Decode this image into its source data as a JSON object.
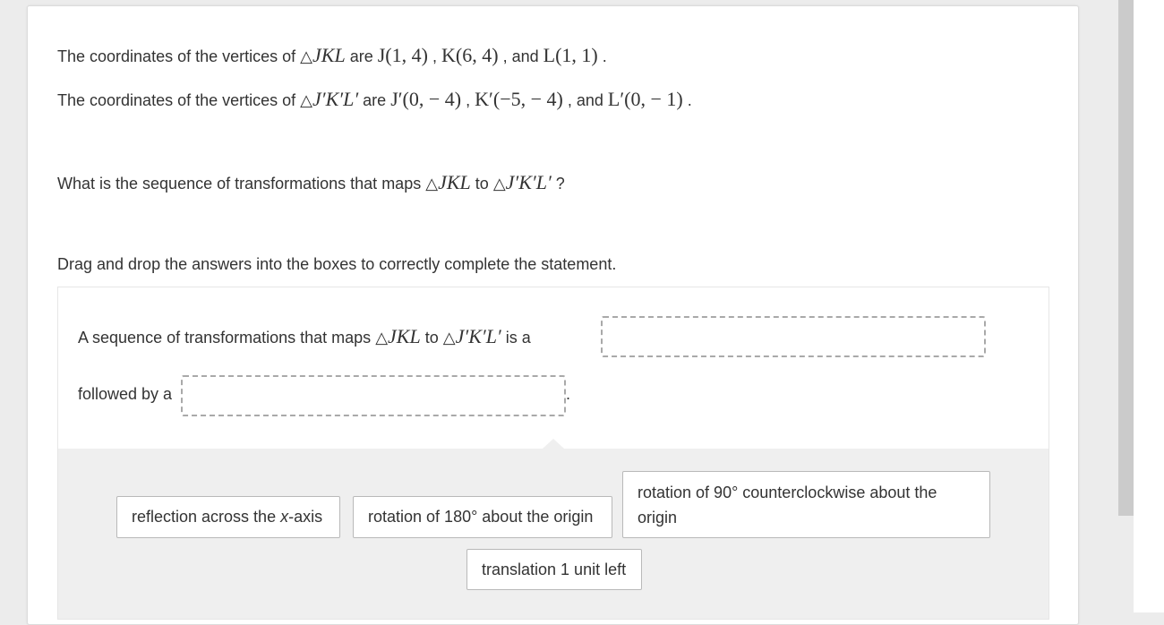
{
  "question": {
    "line1": {
      "prefix": "The coordinates of the vertices of",
      "triangle": "△",
      "name": "JKL",
      "are": "are",
      "v1": "J(1,  4)",
      "sep1": ",",
      "v2": "K(6,  4)",
      "sep2": ", and",
      "v3": "L(1,  1)",
      "end": "."
    },
    "line2": {
      "prefix": "The coordinates of the vertices of",
      "triangle": "△",
      "name": "J′K′L′",
      "are": "are",
      "v1": "J′(0,  − 4)",
      "sep1": ",",
      "v2": "K′(−5,  − 4)",
      "sep2": ", and",
      "v3": "L′(0,  − 1)",
      "end": "."
    },
    "prompt": {
      "prefix": "What is the sequence of transformations that maps",
      "triangle": "△",
      "from": "JKL",
      "to_word": "to",
      "to": "J′K′L′",
      "end": "?"
    },
    "instruction": "Drag and drop the answers into the boxes to correctly complete the statement."
  },
  "statement": {
    "part1": "A sequence of transformations that maps",
    "triangle": "△",
    "from": "JKL",
    "to_word": "to",
    "to": "J′K′L′",
    "part2": "is a",
    "part3": "followed by a",
    "end": "."
  },
  "drop_targets": [
    {
      "value": ""
    },
    {
      "value": ""
    }
  ],
  "answer_tiles": [
    {
      "pre": "reflection across the ",
      "italic": "x",
      "post": "-axis"
    },
    {
      "label": "rotation of 180° about the origin"
    },
    {
      "label": "rotation of 90° counterclockwise about the origin"
    },
    {
      "label": "translation 1 unit left"
    }
  ]
}
